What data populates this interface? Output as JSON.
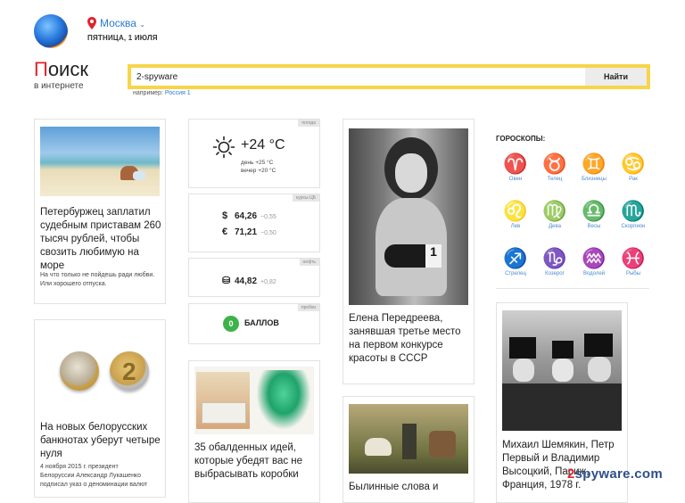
{
  "header": {
    "city": "Москва",
    "date": "ПЯТНИЦА, 1 ИЮЛЯ",
    "brand_title_first": "П",
    "brand_title_rest": "оиск",
    "brand_subtitle": "в интернете"
  },
  "search": {
    "value": "2-spyware",
    "button": "Найти",
    "example_label": "например:",
    "example_link": "Россия 1",
    "accent": "#f7d54a"
  },
  "news": [
    {
      "title": "Петербуржец заплатил судебным приставам 260 тысяч рублей, чтобы свозить любимую на море",
      "desc": "На что только не пойдешь ради любви. Или хорошего отпуска."
    },
    {
      "title": "На новых белорусских банкнотах уберут четыре нуля",
      "desc": "4 ноября 2015 г. президент Белоруссии Александр Лукашенко подписал указ о деноминации валют"
    },
    {
      "title": "Елена Передреева, занявшая третье место на первом конкурсе красоты в СССР"
    },
    {
      "title": "35 обалденных идей, которые убедят вас не выбрасывать коробки"
    },
    {
      "title": "Былинные слова и"
    },
    {
      "title": "Михаил Шемякин, Петр Первый и Владимир Высоцкий, Париж, Франция, 1978 г."
    }
  ],
  "widgets": {
    "weather": {
      "tag": "погода",
      "temp": "+24 °C",
      "day": "день +25 °C",
      "evening": "вечер +20 °C"
    },
    "currency": {
      "tag": "курсы ЦБ",
      "usd_sym": "$",
      "usd": "64,26",
      "usd_chg": "−0,55",
      "eur_sym": "€",
      "eur": "71,21",
      "eur_chg": "−0,50"
    },
    "oil": {
      "tag": "нефть",
      "value": "44,82",
      "chg": "+0,82"
    },
    "traffic": {
      "tag": "пробки",
      "score": "0",
      "label": "БАЛЛОВ"
    }
  },
  "horoscope": {
    "title": "ГОРОСКОПЫ:",
    "signs": [
      {
        "glyph": "♈",
        "name": "Овен"
      },
      {
        "glyph": "♉",
        "name": "Телец"
      },
      {
        "glyph": "♊",
        "name": "Близнецы"
      },
      {
        "glyph": "♋",
        "name": "Рак"
      },
      {
        "glyph": "♌",
        "name": "Лев"
      },
      {
        "glyph": "♍",
        "name": "Дева"
      },
      {
        "glyph": "♎",
        "name": "Весы"
      },
      {
        "glyph": "♏",
        "name": "Скорпион"
      },
      {
        "glyph": "♐",
        "name": "Стрелец"
      },
      {
        "glyph": "♑",
        "name": "Козерог"
      },
      {
        "glyph": "♒",
        "name": "Водолей"
      },
      {
        "glyph": "♓",
        "name": "Рыбы"
      }
    ]
  },
  "watermark": {
    "two": "2",
    "rest": "spyware.com"
  }
}
